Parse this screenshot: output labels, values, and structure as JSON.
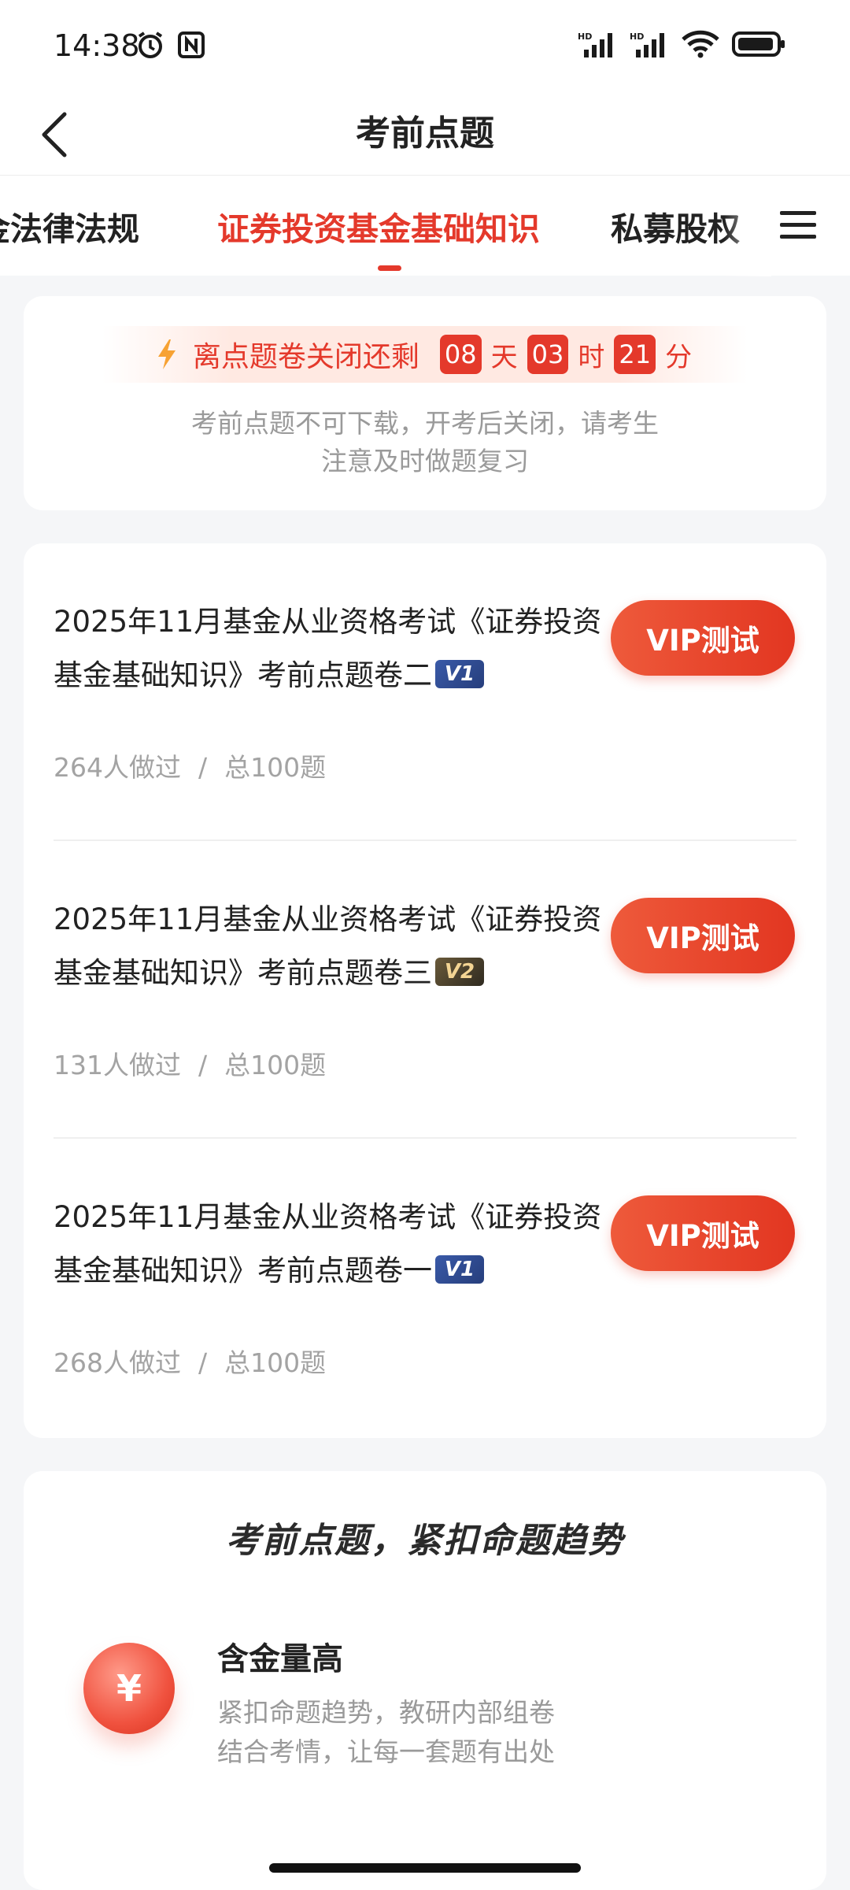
{
  "status_bar": {
    "time": "14:38",
    "icons_left": [
      "alarm-icon",
      "nfc-icon"
    ],
    "icons_right": [
      "hd-signal-icon",
      "hd-signal-icon",
      "wifi-icon",
      "battery-icon"
    ],
    "hd_label": "HD"
  },
  "header": {
    "title": "考前点题",
    "back_icon": "chevron-left-icon"
  },
  "tabs": {
    "items": [
      {
        "label": "金法律法规"
      },
      {
        "label": "证券投资基金基础知识"
      },
      {
        "label": "私募股权"
      }
    ],
    "active_index": 1,
    "menu_icon": "hamburger-menu-icon"
  },
  "countdown": {
    "label": "离点题卷关闭还剩",
    "days": "08",
    "day_unit": "天",
    "hours": "03",
    "hour_unit": "时",
    "minutes": "21",
    "minute_unit": "分",
    "note_line1": "考前点题不可下载，开考后关闭，请考生",
    "note_line2": "注意及时做题复习",
    "accent": "#e4392b"
  },
  "exams": [
    {
      "title": "2025年11月基金从业资格考试《证券投资基金基础知识》考前点题卷二",
      "badge": "V1",
      "done_count": "264人做过",
      "separator": "/",
      "total": "总100题",
      "button_label": "VIP测试"
    },
    {
      "title": "2025年11月基金从业资格考试《证券投资基金基础知识》考前点题卷三",
      "badge": "V2",
      "done_count": "131人做过",
      "separator": "/",
      "total": "总100题",
      "button_label": "VIP测试"
    },
    {
      "title": "2025年11月基金从业资格考试《证券投资基金基础知识》考前点题卷一",
      "badge": "V1",
      "done_count": "268人做过",
      "separator": "/",
      "total": "总100题",
      "button_label": "VIP测试"
    }
  ],
  "promo": {
    "title": "考前点题，紧扣命题趋势",
    "feature_icon_glyph": "¥",
    "feature_title": "含金量高",
    "feature_desc_line1": "紧扣命题趋势，教研内部组卷",
    "feature_desc_line2": "结合考情，让每一套题有出处"
  }
}
